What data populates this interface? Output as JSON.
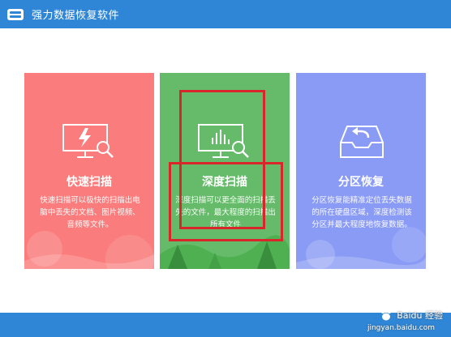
{
  "window": {
    "title": "强力数据恢复软件"
  },
  "cards": [
    {
      "title": "快速扫描",
      "desc": "快速扫描可以极快的扫描出电脑中丢失的文档、图片视频、音频等文件。",
      "icon": "monitor-lightning-icon",
      "color": "#fa7c7c"
    },
    {
      "title": "深度扫描",
      "desc": "深度扫描可以更全面的扫描丢失的文件，最大程度的扫描出所有文件",
      "icon": "monitor-chart-icon",
      "color": "#66bb6a"
    },
    {
      "title": "分区恢复",
      "desc": "分区恢复能精准定位丢失数据的所在硬盘区域，深度检测该分区并最大程度地恢复数据。",
      "icon": "inbox-return-icon",
      "color": "#8a9bf5"
    }
  ],
  "watermark": {
    "brand": "Baidu 经验",
    "url": "jingyan.baidu.com"
  },
  "colors": {
    "titlebar": "#2f86d6",
    "highlight": "#d8262a"
  }
}
